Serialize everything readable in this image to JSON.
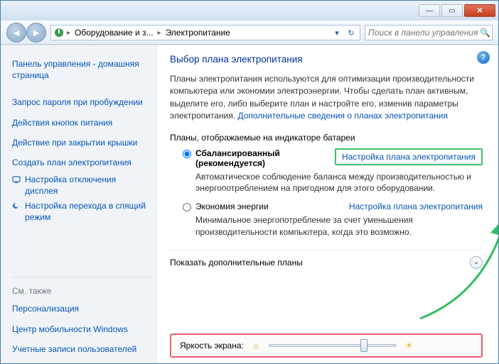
{
  "titlebar": {
    "min": "—",
    "max": "▭",
    "close": "✕"
  },
  "toolbar": {
    "back": "◄",
    "forward": "►",
    "crumb1": "Оборудование и з...",
    "crumb2": "Электропитание",
    "search_placeholder": "Поиск в панели управления"
  },
  "sidebar": {
    "home": "Панель управления - домашняя страница",
    "links": [
      "Запрос пароля при пробуждении",
      "Действия кнопок питания",
      "Действие при закрытии крышки",
      "Создать план электропитания",
      "Настройка отключения дисплея",
      "Настройка перехода в спящий режим"
    ],
    "see_also_caption": "См. также",
    "see_also": [
      "Персонализация",
      "Центр мобильности Windows",
      "Учетные записи пользователей"
    ]
  },
  "main": {
    "help": "?",
    "title": "Выбор плана электропитания",
    "intro_pre": "Планы электропитания используются для оптимизации производительности компьютера или экономии электроэнергии. Чтобы сделать план активным, выделите его, либо выберите план и настройте его, изменив параметры электропитания. ",
    "intro_link": "Дополнительные сведения о планах электропитания",
    "section": "Планы, отображаемые на индикаторе батареи",
    "plan1": {
      "name": "Сбалансированный (рекомендуется)",
      "settings": "Настройка плана электропитания",
      "desc": "Автоматическое соблюдение баланса между производительностью и энергопотреблением на пригодном для этого оборудовании."
    },
    "plan2": {
      "name": "Экономия энергии",
      "settings": "Настройка плана электропитания",
      "desc": "Минимальное энергопотребление за счет уменьшения производительности компьютера, когда это возможно."
    },
    "more": "Показать дополнительные планы",
    "brightness_label": "Яркость экрана:"
  }
}
